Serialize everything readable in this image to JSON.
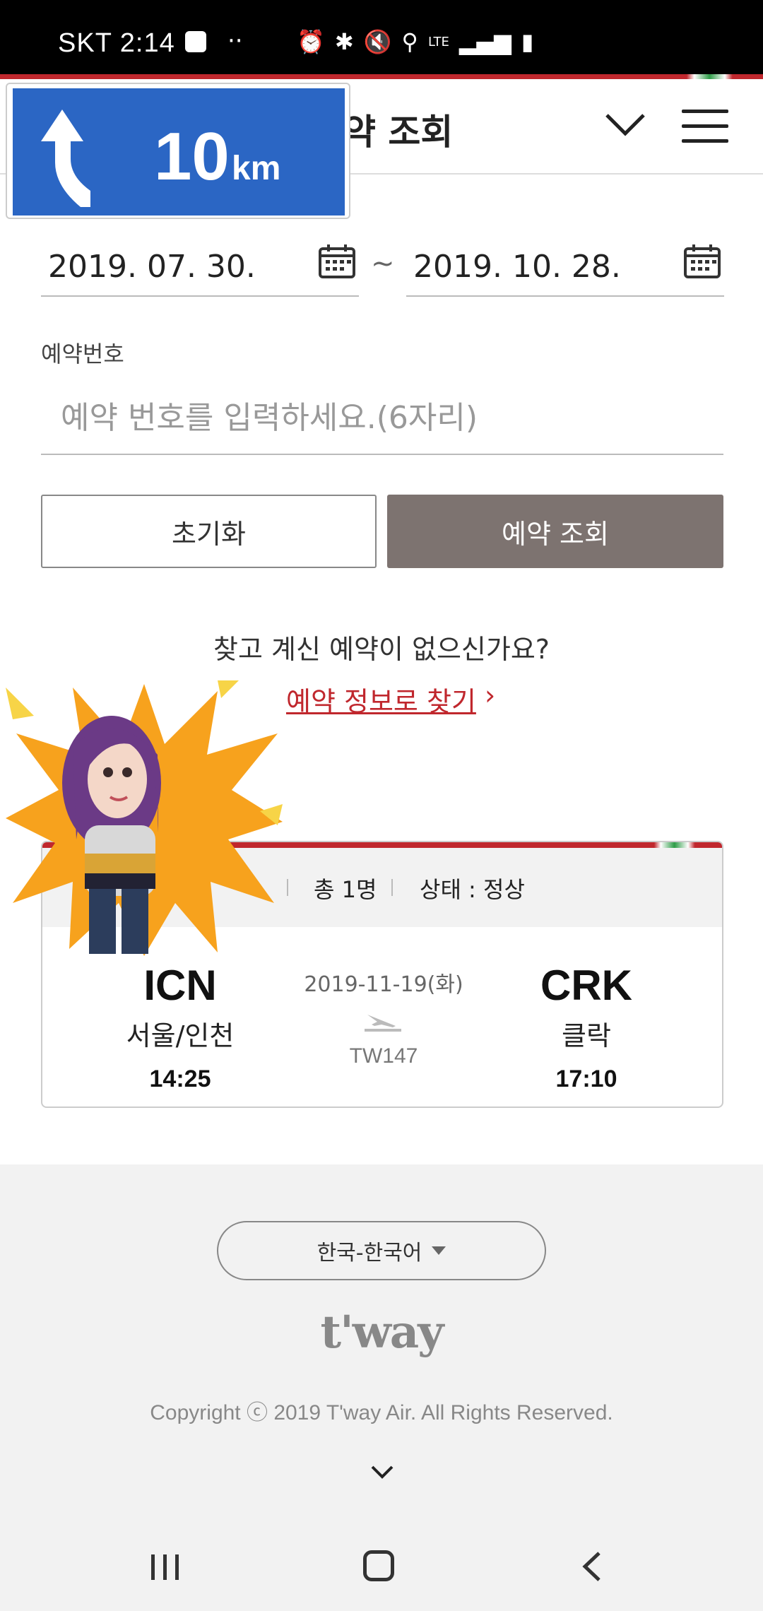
{
  "status_bar": {
    "carrier_time": "SKT 2:14",
    "dots": "··",
    "icons": [
      "alarm-icon",
      "bluetooth-icon",
      "mute-icon",
      "location-icon",
      "lte-icon",
      "signal-icon",
      "battery-icon"
    ],
    "lte_label": "LTE"
  },
  "header": {
    "title": "예약 조회"
  },
  "navigation_overlay": {
    "distance": "10",
    "unit": "km",
    "color": "#2b66c4"
  },
  "form": {
    "start_date": "2019. 07. 30.",
    "end_date": "2019. 10. 28.",
    "range_separator": "~",
    "reservation_label": "예약번호",
    "reservation_placeholder": "예약 번호를 입력하세요.(6자리)",
    "reservation_value": "",
    "reset_label": "초기화",
    "search_label": "예약 조회"
  },
  "notice": {
    "question": "찾고 계신 예약이 없으신가요?",
    "link_label": "예약 정보로 찾기",
    "link_arrow": "›"
  },
  "reservation_card": {
    "passenger_count": "총 1명",
    "status": "상태 : 정상",
    "departure": {
      "code": "ICN",
      "city": "서울/인천",
      "time": "14:25"
    },
    "arrival": {
      "code": "CRK",
      "city": "클락",
      "time": "17:10"
    },
    "date": "2019-11-19(화)",
    "flight_number": "TW147"
  },
  "footer": {
    "language": "한국-한국어",
    "logo": "t'way",
    "copyright": "Copyright ⓒ 2019 T'way Air. All Rights Reserved."
  },
  "colors": {
    "brand_red": "#c0272d",
    "search_button": "#7d7370",
    "sticker_burst": "#f7a21d"
  }
}
